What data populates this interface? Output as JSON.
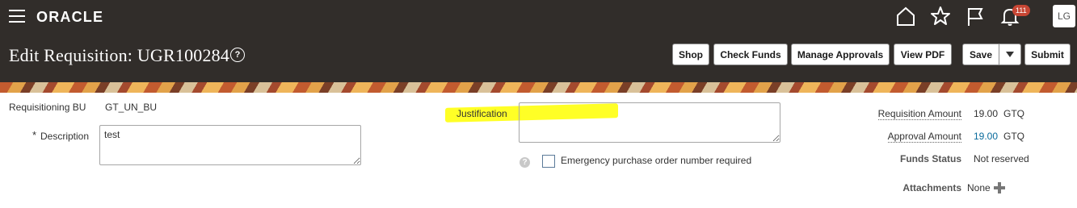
{
  "header": {
    "brand": "ORACLE",
    "notification_count": "111",
    "user_initials": "LG",
    "page_title": "Edit Requisition: UGR100284",
    "help_glyph": "?",
    "icons": [
      "menu-icon",
      "home-icon",
      "star-icon",
      "flag-icon",
      "bell-icon"
    ]
  },
  "toolbar": {
    "shop": "Shop",
    "check_funds": "Check Funds",
    "manage_approvals": "Manage Approvals",
    "view_pdf": "View PDF",
    "save": "Save",
    "submit": "Submit"
  },
  "form": {
    "requisitioning_bu_label": "Requisitioning BU",
    "requisitioning_bu_value": "GT_UN_BU",
    "required_marker": "*",
    "description_label": "Description",
    "description_value": "test",
    "justification_label": "Justification",
    "justification_value": "",
    "emergency_label": "Emergency purchase order number required",
    "emergency_checked": false
  },
  "summary": {
    "requisition_amount_label": "Requisition Amount",
    "requisition_amount": "19.00",
    "requisition_currency": "GTQ",
    "approval_amount_label": "Approval Amount",
    "approval_amount": "19.00",
    "approval_currency": "GTQ",
    "funds_status_label": "Funds Status",
    "funds_status": "Not reserved",
    "attachments_label": "Attachments",
    "attachments_value": "None"
  },
  "colors": {
    "header_bg": "#312d2a",
    "badge": "#c74634",
    "highlight": "#ffff00",
    "link": "#0a6b9c"
  }
}
